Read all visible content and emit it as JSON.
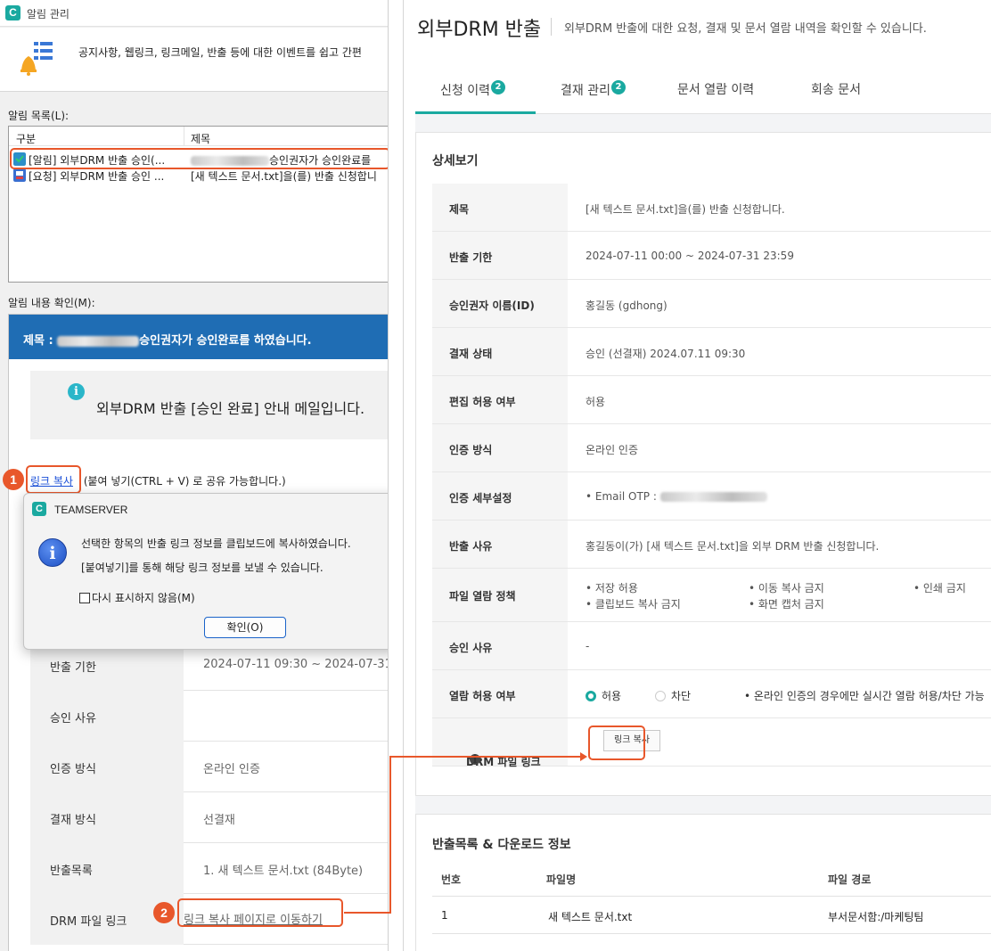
{
  "left": {
    "window_title": "알림 관리",
    "banner_text": "공지사항, 웹링크, 링크메일, 반출 등에 대한 이벤트를 쉽고 간편",
    "list_label": "알림 목록(L):",
    "list_headers": [
      "구분",
      "제목"
    ],
    "list_rows": [
      {
        "type": "[알림] 외부DRM 반출 승인(...",
        "subject": "승인권자가 승인완료를"
      },
      {
        "type": "[요청] 외부DRM 반출 승인 ...",
        "subject": "[새 텍스트 문서.txt]을(를) 반출 신청합니"
      }
    ],
    "content_label": "알림 내용 확인(M):",
    "blue_title_prefix": "제목 :",
    "blue_title_suffix": "승인권자가 승인완료를 하였습니다.",
    "info_text": "외부DRM 반출 [승인 완료] 안내 메일입니다.",
    "info_icon": "info-circle-icon",
    "copy_link_label": "링크 복사",
    "copy_hint": "(붙여 넣기(CTRL + V) 로 공유 가능합니다.)",
    "step1": "1",
    "step2": "2",
    "dialog": {
      "title": "TEAMSERVER",
      "line1": "선택한 항목의 반출 링크 정보를 클립보드에 복사하였습니다.",
      "line2": "[붙여넣기]를 통해 해당 링크 정보를 보낼 수 있습니다.",
      "checkbox": "다시 표시하지 않음(M)",
      "ok": "확인(O)"
    },
    "details": [
      {
        "key": "반출 기한",
        "value": "2024-07-11 09:30 ~ 2024-07-31 2"
      },
      {
        "key": "승인 사유",
        "value": ""
      },
      {
        "key": "인증 방식",
        "value": "온라인 인증"
      },
      {
        "key": "결재 방식",
        "value": "선결재"
      },
      {
        "key": "반출목록",
        "value": "1. 새 텍스트 문서.txt (84Byte)"
      },
      {
        "key": "DRM 파일 링크",
        "value": "링크 복사 페이지로 이동하기"
      }
    ]
  },
  "right": {
    "title": "외부DRM 반출",
    "subtitle": "외부DRM 반출에 대한 요청, 결재 및 문서 열람 내역을 확인할 수 있습니다.",
    "tabs": [
      {
        "label": "신청 이력",
        "count": "2"
      },
      {
        "label": "결재 관리",
        "count": "2"
      },
      {
        "label": "문서 열람 이력",
        "count": ""
      },
      {
        "label": "회송 문서",
        "count": ""
      }
    ],
    "detail_title": "상세보기",
    "rows": {
      "title_key": "제목",
      "title_val": "[새 텍스트 문서.txt]을(를) 반출 신청합니다.",
      "period_key": "반출 기한",
      "period_val": "2024-07-11 00:00 ~ 2024-07-31 23:59",
      "approver_key": "승인권자 이름(ID)",
      "approver_val": "홍길동 (gdhong)",
      "status_key": "결재 상태",
      "status_val": "승인 (선결재) 2024.07.11 09:30",
      "edit_key": "편집 허용 여부",
      "edit_val": "허용",
      "auth_key": "인증 방식",
      "auth_val": "온라인 인증",
      "auth_detail_key": "인증 세부설정",
      "auth_detail_val": "• Email OTP :",
      "reason_key": "반출 사유",
      "reason_val": "홍길동이(가) [새 텍스트 문서.txt]을 외부 DRM 반출 신청합니다.",
      "policy_key": "파일 열람 정책",
      "policy_items": [
        "• 저장 허용",
        "• 이동 복사 금지",
        "• 인쇄 금지",
        "• 클립보드 복사 금지",
        "• 화면 캡처 금지"
      ],
      "approve_reason_key": "승인 사유",
      "approve_reason_val": "-",
      "view_key": "열람 허용 여부",
      "view_allow": "허용",
      "view_block": "차단",
      "view_note": "•   온라인 인증의 경우에만 실시간 열람 허용/차단 가능",
      "link_key": "DRM 파일 링크",
      "link_btn": "링크 복사"
    },
    "list_title": "반출목록 & 다운로드 정보",
    "list_headers": [
      "번호",
      "파일명",
      "파일 경로"
    ],
    "list_rows": [
      {
        "no": "1",
        "name": "새 텍스트 문서.txt",
        "path": "부서문서함:/마케팅팀"
      }
    ]
  },
  "colors": {
    "accent": "#1aa9a0",
    "highlight": "#e8572b",
    "bluebar": "#1f6db4"
  }
}
